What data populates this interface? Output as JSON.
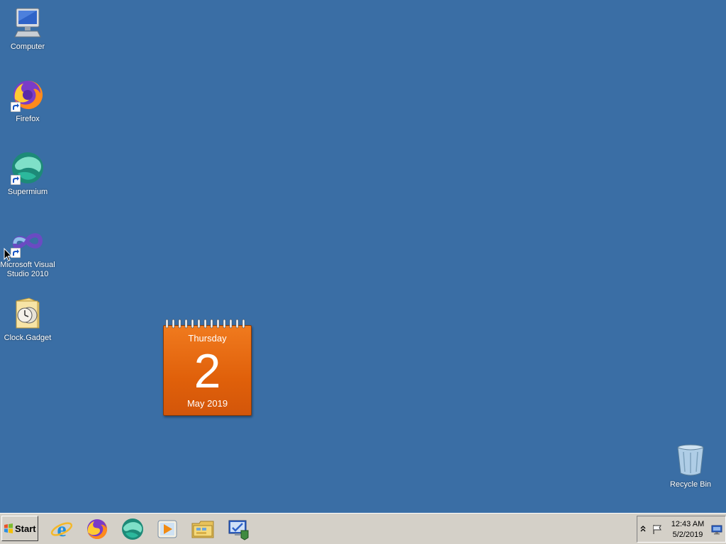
{
  "desktop": {
    "background_color": "#3a6ea5",
    "icons": [
      {
        "label": "Computer",
        "icon": "computer-icon"
      },
      {
        "label": "Firefox",
        "icon": "firefox-icon"
      },
      {
        "label": "Supermium",
        "icon": "supermium-icon"
      },
      {
        "label": "Microsoft Visual Studio 2010",
        "icon": "visual-studio-icon"
      },
      {
        "label": "Clock.Gadget",
        "icon": "clock-gadget-icon"
      },
      {
        "label": "Recycle Bin",
        "icon": "recycle-bin-icon"
      }
    ]
  },
  "calendar_gadget": {
    "weekday": "Thursday",
    "day": "2",
    "month_year": "May 2019",
    "color": "#e8680f"
  },
  "taskbar": {
    "start_label": "Start",
    "pinned": [
      {
        "name": "Internet Explorer",
        "icon": "internet-explorer-icon"
      },
      {
        "name": "Firefox",
        "icon": "firefox-icon"
      },
      {
        "name": "Supermium",
        "icon": "supermium-icon"
      },
      {
        "name": "Media Player",
        "icon": "media-player-icon"
      },
      {
        "name": "File Explorer",
        "icon": "file-explorer-icon"
      },
      {
        "name": "Control Panel",
        "icon": "control-panel-icon"
      }
    ],
    "tray": {
      "time": "12:43 AM",
      "date": "5/2/2019"
    }
  }
}
